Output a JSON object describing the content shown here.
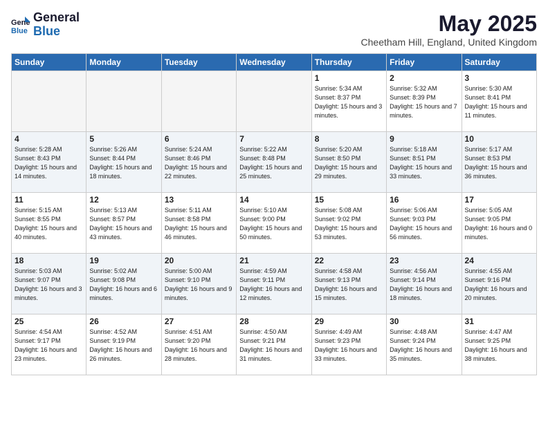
{
  "logo": {
    "general": "General",
    "blue": "Blue"
  },
  "title": "May 2025",
  "location": "Cheetham Hill, England, United Kingdom",
  "weekdays": [
    "Sunday",
    "Monday",
    "Tuesday",
    "Wednesday",
    "Thursday",
    "Friday",
    "Saturday"
  ],
  "weeks": [
    [
      {
        "day": "",
        "info": ""
      },
      {
        "day": "",
        "info": ""
      },
      {
        "day": "",
        "info": ""
      },
      {
        "day": "",
        "info": ""
      },
      {
        "day": "1",
        "info": "Sunrise: 5:34 AM\nSunset: 8:37 PM\nDaylight: 15 hours\nand 3 minutes."
      },
      {
        "day": "2",
        "info": "Sunrise: 5:32 AM\nSunset: 8:39 PM\nDaylight: 15 hours\nand 7 minutes."
      },
      {
        "day": "3",
        "info": "Sunrise: 5:30 AM\nSunset: 8:41 PM\nDaylight: 15 hours\nand 11 minutes."
      }
    ],
    [
      {
        "day": "4",
        "info": "Sunrise: 5:28 AM\nSunset: 8:43 PM\nDaylight: 15 hours\nand 14 minutes."
      },
      {
        "day": "5",
        "info": "Sunrise: 5:26 AM\nSunset: 8:44 PM\nDaylight: 15 hours\nand 18 minutes."
      },
      {
        "day": "6",
        "info": "Sunrise: 5:24 AM\nSunset: 8:46 PM\nDaylight: 15 hours\nand 22 minutes."
      },
      {
        "day": "7",
        "info": "Sunrise: 5:22 AM\nSunset: 8:48 PM\nDaylight: 15 hours\nand 25 minutes."
      },
      {
        "day": "8",
        "info": "Sunrise: 5:20 AM\nSunset: 8:50 PM\nDaylight: 15 hours\nand 29 minutes."
      },
      {
        "day": "9",
        "info": "Sunrise: 5:18 AM\nSunset: 8:51 PM\nDaylight: 15 hours\nand 33 minutes."
      },
      {
        "day": "10",
        "info": "Sunrise: 5:17 AM\nSunset: 8:53 PM\nDaylight: 15 hours\nand 36 minutes."
      }
    ],
    [
      {
        "day": "11",
        "info": "Sunrise: 5:15 AM\nSunset: 8:55 PM\nDaylight: 15 hours\nand 40 minutes."
      },
      {
        "day": "12",
        "info": "Sunrise: 5:13 AM\nSunset: 8:57 PM\nDaylight: 15 hours\nand 43 minutes."
      },
      {
        "day": "13",
        "info": "Sunrise: 5:11 AM\nSunset: 8:58 PM\nDaylight: 15 hours\nand 46 minutes."
      },
      {
        "day": "14",
        "info": "Sunrise: 5:10 AM\nSunset: 9:00 PM\nDaylight: 15 hours\nand 50 minutes."
      },
      {
        "day": "15",
        "info": "Sunrise: 5:08 AM\nSunset: 9:02 PM\nDaylight: 15 hours\nand 53 minutes."
      },
      {
        "day": "16",
        "info": "Sunrise: 5:06 AM\nSunset: 9:03 PM\nDaylight: 15 hours\nand 56 minutes."
      },
      {
        "day": "17",
        "info": "Sunrise: 5:05 AM\nSunset: 9:05 PM\nDaylight: 16 hours\nand 0 minutes."
      }
    ],
    [
      {
        "day": "18",
        "info": "Sunrise: 5:03 AM\nSunset: 9:07 PM\nDaylight: 16 hours\nand 3 minutes."
      },
      {
        "day": "19",
        "info": "Sunrise: 5:02 AM\nSunset: 9:08 PM\nDaylight: 16 hours\nand 6 minutes."
      },
      {
        "day": "20",
        "info": "Sunrise: 5:00 AM\nSunset: 9:10 PM\nDaylight: 16 hours\nand 9 minutes."
      },
      {
        "day": "21",
        "info": "Sunrise: 4:59 AM\nSunset: 9:11 PM\nDaylight: 16 hours\nand 12 minutes."
      },
      {
        "day": "22",
        "info": "Sunrise: 4:58 AM\nSunset: 9:13 PM\nDaylight: 16 hours\nand 15 minutes."
      },
      {
        "day": "23",
        "info": "Sunrise: 4:56 AM\nSunset: 9:14 PM\nDaylight: 16 hours\nand 18 minutes."
      },
      {
        "day": "24",
        "info": "Sunrise: 4:55 AM\nSunset: 9:16 PM\nDaylight: 16 hours\nand 20 minutes."
      }
    ],
    [
      {
        "day": "25",
        "info": "Sunrise: 4:54 AM\nSunset: 9:17 PM\nDaylight: 16 hours\nand 23 minutes."
      },
      {
        "day": "26",
        "info": "Sunrise: 4:52 AM\nSunset: 9:19 PM\nDaylight: 16 hours\nand 26 minutes."
      },
      {
        "day": "27",
        "info": "Sunrise: 4:51 AM\nSunset: 9:20 PM\nDaylight: 16 hours\nand 28 minutes."
      },
      {
        "day": "28",
        "info": "Sunrise: 4:50 AM\nSunset: 9:21 PM\nDaylight: 16 hours\nand 31 minutes."
      },
      {
        "day": "29",
        "info": "Sunrise: 4:49 AM\nSunset: 9:23 PM\nDaylight: 16 hours\nand 33 minutes."
      },
      {
        "day": "30",
        "info": "Sunrise: 4:48 AM\nSunset: 9:24 PM\nDaylight: 16 hours\nand 35 minutes."
      },
      {
        "day": "31",
        "info": "Sunrise: 4:47 AM\nSunset: 9:25 PM\nDaylight: 16 hours\nand 38 minutes."
      }
    ]
  ]
}
